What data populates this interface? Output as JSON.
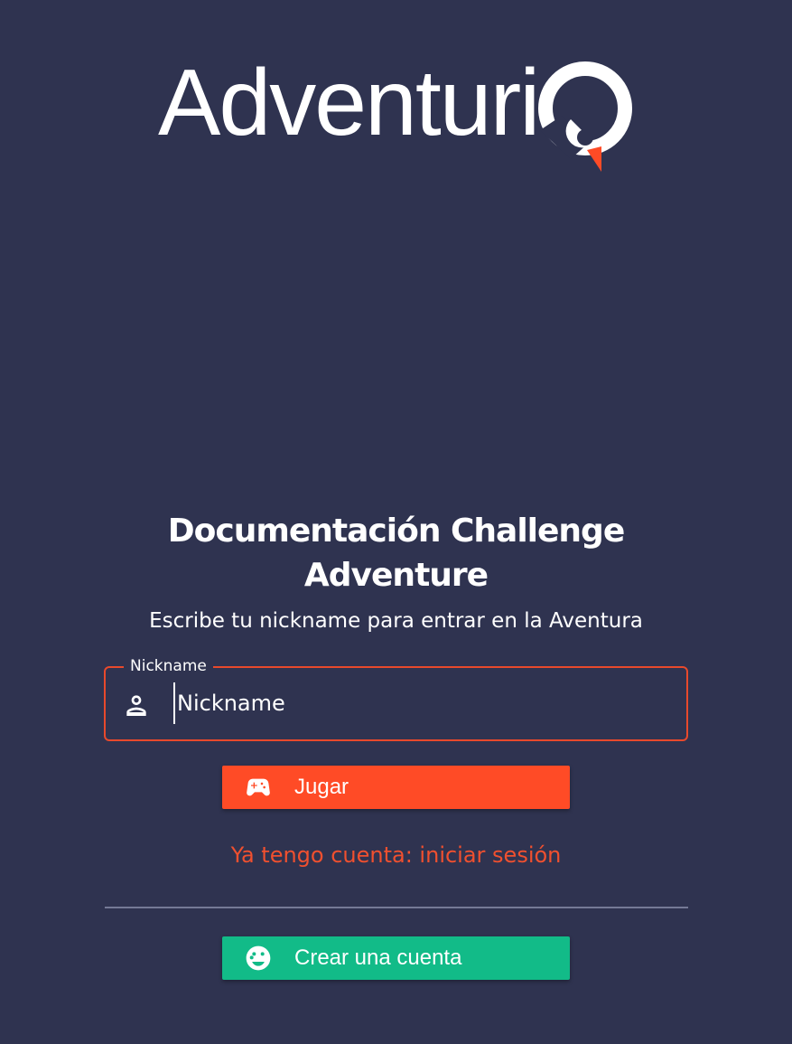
{
  "brand": {
    "name": "Adventuri",
    "accent_color": "#ff4b26"
  },
  "main": {
    "title": "Documentación Challenge Adventure",
    "subtitle": "Escribe tu nickname para entrar en la Aventura"
  },
  "nickname_field": {
    "legend": "Nickname",
    "placeholder": "Nickname",
    "value": "",
    "icon": "person-icon",
    "border_color": "#e8492c"
  },
  "play_button": {
    "label": "Jugar",
    "icon": "gamepad-icon",
    "color": "#ff4b26"
  },
  "login_link": {
    "label": "Ya tengo cuenta: iniciar sesión"
  },
  "create_button": {
    "label": "Crear una cuenta",
    "icon": "face-icon",
    "color": "#12bb88"
  }
}
